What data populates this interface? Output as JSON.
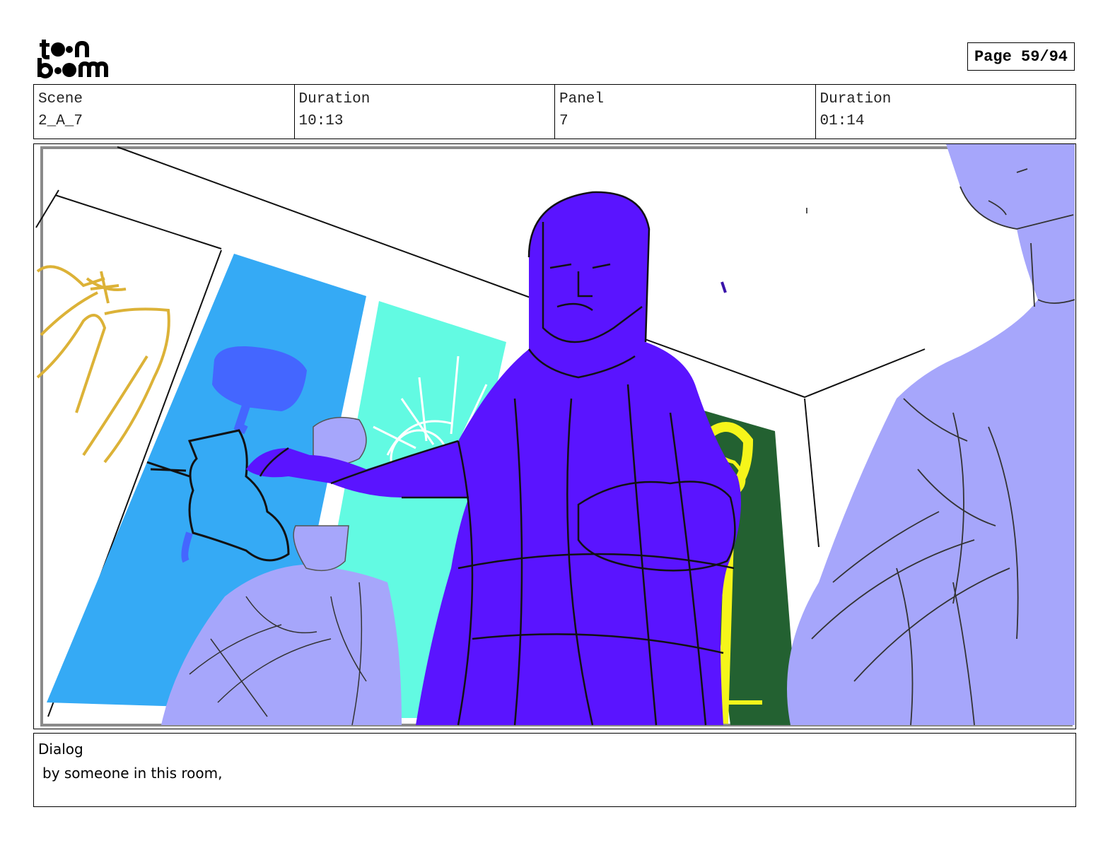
{
  "header": {
    "logo_text": "toon boom",
    "page_label": "Page 59/94"
  },
  "info": {
    "scene_label": "Scene",
    "scene_value": "2_A_7",
    "scene_duration_label": "Duration",
    "scene_duration_value": "10:13",
    "panel_label": "Panel",
    "panel_value": "7",
    "panel_duration_label": "Duration",
    "panel_duration_value": "01:14"
  },
  "dialog": {
    "label": "Dialog",
    "text": "by someone in this room,"
  },
  "colors": {
    "robe_purple": "#5a14ff",
    "lavender": "#a6a6fb",
    "sky_blue": "#35aaf5",
    "aqua": "#62fae2",
    "dark_green": "#236131",
    "yellow": "#f5f51a",
    "ochre": "#dcb237"
  }
}
